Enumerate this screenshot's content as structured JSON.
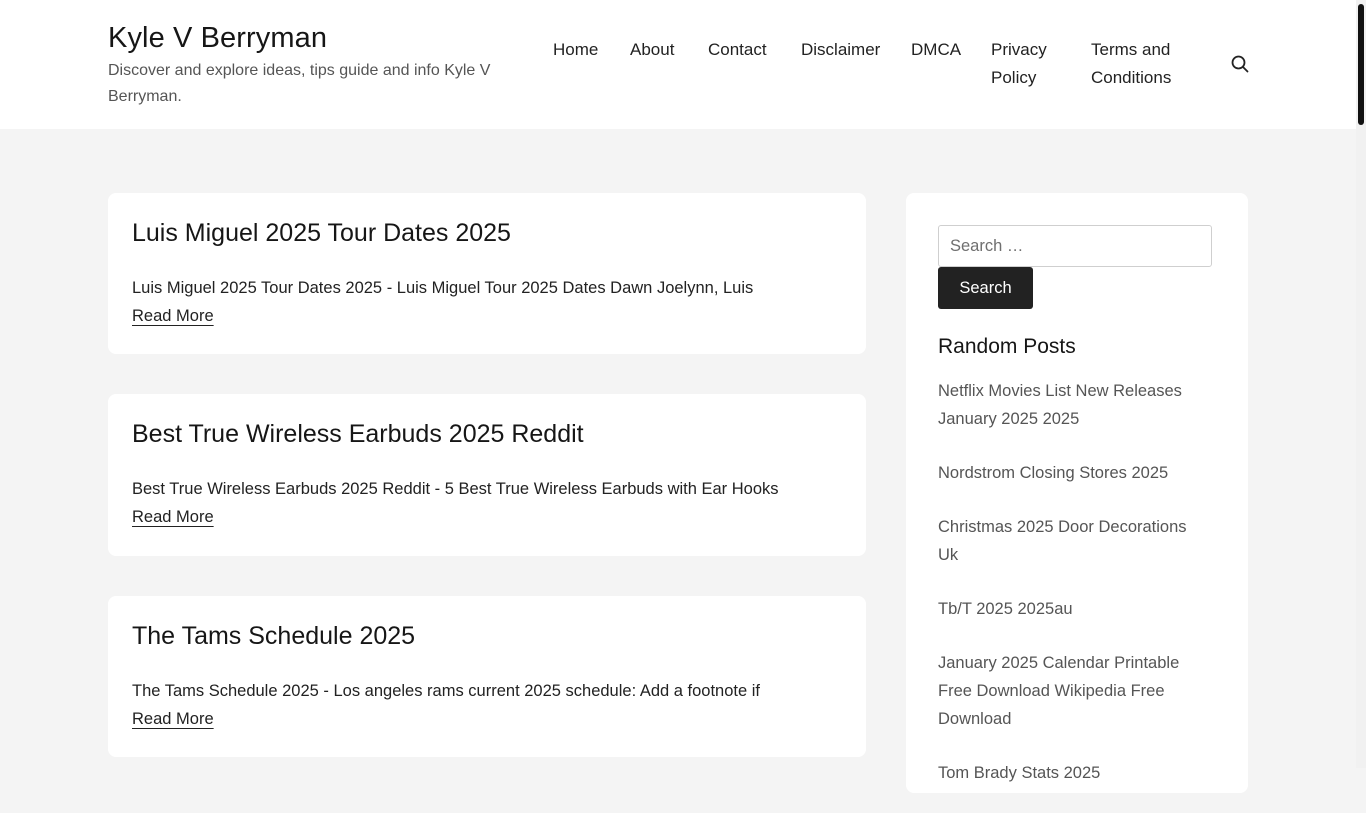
{
  "site": {
    "title": "Kyle V Berryman",
    "description": "Discover and explore ideas, tips guide and info Kyle V Berryman."
  },
  "nav": {
    "items": [
      {
        "label": "Home"
      },
      {
        "label": "About"
      },
      {
        "label": "Contact"
      },
      {
        "label": "Disclaimer"
      },
      {
        "label": "DMCA"
      },
      {
        "label": "Privacy Policy"
      },
      {
        "label": "Terms and Conditions"
      }
    ],
    "search_icon": "search-icon"
  },
  "posts": [
    {
      "title": "Luis Miguel 2025 Tour Dates 2025",
      "excerpt": "Luis Miguel 2025 Tour Dates 2025 - Luis Miguel Tour 2025 Dates Dawn Joelynn, Luis",
      "read_more": "Read More"
    },
    {
      "title": "Best True Wireless Earbuds 2025 Reddit",
      "excerpt": "Best True Wireless Earbuds 2025 Reddit - 5 Best True Wireless Earbuds with Ear Hooks",
      "read_more": "Read More"
    },
    {
      "title": "The Tams Schedule 2025",
      "excerpt": "The Tams Schedule 2025 - Los angeles rams current 2025 schedule: Add a footnote if",
      "read_more": "Read More"
    }
  ],
  "sidebar": {
    "search": {
      "placeholder": "Search …",
      "value": "",
      "button_label": "Search"
    },
    "random_posts": {
      "title": "Random Posts",
      "items": [
        "Netflix Movies List New Releases January 2025 2025",
        "Nordstrom Closing Stores 2025",
        "Christmas 2025 Door Decorations Uk",
        "Tb/T 2025 2025au",
        "January 2025 Calendar Printable Free Download Wikipedia Free Download",
        "Tom Brady Stats 2025"
      ]
    }
  }
}
